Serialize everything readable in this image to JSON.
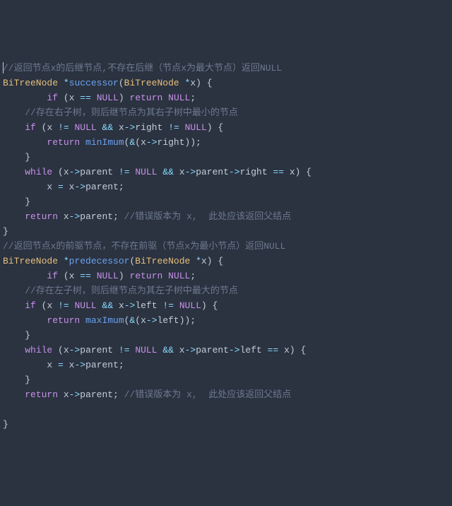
{
  "code": {
    "lines": [
      [
        {
          "cls": "cursor-slot",
          "text": ""
        },
        {
          "cls": "cmt",
          "text": "//返回节点x的后继节点,不存在后继（节点x为最大节点）返回NULL"
        }
      ],
      [
        {
          "cls": "ty",
          "text": "BiTreeNode"
        },
        {
          "cls": "pn",
          "text": " "
        },
        {
          "cls": "op",
          "text": "*"
        },
        {
          "cls": "fn",
          "text": "successor"
        },
        {
          "cls": "pn",
          "text": "("
        },
        {
          "cls": "ty",
          "text": "BiTreeNode"
        },
        {
          "cls": "pn",
          "text": " "
        },
        {
          "cls": "op",
          "text": "*"
        },
        {
          "cls": "id",
          "text": "x"
        },
        {
          "cls": "pn",
          "text": ") {"
        }
      ],
      [
        {
          "cls": "pn",
          "text": "        "
        },
        {
          "cls": "kw",
          "text": "if"
        },
        {
          "cls": "pn",
          "text": " ("
        },
        {
          "cls": "id",
          "text": "x"
        },
        {
          "cls": "pn",
          "text": " "
        },
        {
          "cls": "op",
          "text": "=="
        },
        {
          "cls": "pn",
          "text": " "
        },
        {
          "cls": "kw",
          "text": "NULL"
        },
        {
          "cls": "pn",
          "text": ") "
        },
        {
          "cls": "kw",
          "text": "return"
        },
        {
          "cls": "pn",
          "text": " "
        },
        {
          "cls": "kw",
          "text": "NULL"
        },
        {
          "cls": "pn",
          "text": ";"
        }
      ],
      [
        {
          "cls": "pn",
          "text": "    "
        },
        {
          "cls": "cmt",
          "text": "//存在右子树，则后继节点为其右子树中最小的节点"
        }
      ],
      [
        {
          "cls": "pn",
          "text": "    "
        },
        {
          "cls": "kw",
          "text": "if"
        },
        {
          "cls": "pn",
          "text": " ("
        },
        {
          "cls": "id",
          "text": "x"
        },
        {
          "cls": "pn",
          "text": " "
        },
        {
          "cls": "op",
          "text": "!="
        },
        {
          "cls": "pn",
          "text": " "
        },
        {
          "cls": "kw",
          "text": "NULL"
        },
        {
          "cls": "pn",
          "text": " "
        },
        {
          "cls": "op",
          "text": "&&"
        },
        {
          "cls": "pn",
          "text": " "
        },
        {
          "cls": "id",
          "text": "x"
        },
        {
          "cls": "op",
          "text": "->"
        },
        {
          "cls": "id",
          "text": "right"
        },
        {
          "cls": "pn",
          "text": " "
        },
        {
          "cls": "op",
          "text": "!="
        },
        {
          "cls": "pn",
          "text": " "
        },
        {
          "cls": "kw",
          "text": "NULL"
        },
        {
          "cls": "pn",
          "text": ") {"
        }
      ],
      [
        {
          "cls": "pn",
          "text": "        "
        },
        {
          "cls": "kw",
          "text": "return"
        },
        {
          "cls": "pn",
          "text": " "
        },
        {
          "cls": "fn",
          "text": "minImum"
        },
        {
          "cls": "pn",
          "text": "("
        },
        {
          "cls": "op",
          "text": "&"
        },
        {
          "cls": "pn",
          "text": "("
        },
        {
          "cls": "id",
          "text": "x"
        },
        {
          "cls": "op",
          "text": "->"
        },
        {
          "cls": "id",
          "text": "right"
        },
        {
          "cls": "pn",
          "text": "));"
        }
      ],
      [
        {
          "cls": "pn",
          "text": "    }"
        }
      ],
      [
        {
          "cls": "pn",
          "text": "    "
        },
        {
          "cls": "kw",
          "text": "while"
        },
        {
          "cls": "pn",
          "text": " ("
        },
        {
          "cls": "id",
          "text": "x"
        },
        {
          "cls": "op",
          "text": "->"
        },
        {
          "cls": "id",
          "text": "parent"
        },
        {
          "cls": "pn",
          "text": " "
        },
        {
          "cls": "op",
          "text": "!="
        },
        {
          "cls": "pn",
          "text": " "
        },
        {
          "cls": "kw",
          "text": "NULL"
        },
        {
          "cls": "pn",
          "text": " "
        },
        {
          "cls": "op",
          "text": "&&"
        },
        {
          "cls": "pn",
          "text": " "
        },
        {
          "cls": "id",
          "text": "x"
        },
        {
          "cls": "op",
          "text": "->"
        },
        {
          "cls": "id",
          "text": "parent"
        },
        {
          "cls": "op",
          "text": "->"
        },
        {
          "cls": "id",
          "text": "right"
        },
        {
          "cls": "pn",
          "text": " "
        },
        {
          "cls": "op",
          "text": "=="
        },
        {
          "cls": "pn",
          "text": " "
        },
        {
          "cls": "id",
          "text": "x"
        },
        {
          "cls": "pn",
          "text": ") {"
        }
      ],
      [
        {
          "cls": "pn",
          "text": "        "
        },
        {
          "cls": "id",
          "text": "x"
        },
        {
          "cls": "pn",
          "text": " "
        },
        {
          "cls": "op",
          "text": "="
        },
        {
          "cls": "pn",
          "text": " "
        },
        {
          "cls": "id",
          "text": "x"
        },
        {
          "cls": "op",
          "text": "->"
        },
        {
          "cls": "id",
          "text": "parent"
        },
        {
          "cls": "pn",
          "text": ";"
        }
      ],
      [
        {
          "cls": "pn",
          "text": "    }"
        }
      ],
      [
        {
          "cls": "pn",
          "text": "    "
        },
        {
          "cls": "kw",
          "text": "return"
        },
        {
          "cls": "pn",
          "text": " "
        },
        {
          "cls": "id",
          "text": "x"
        },
        {
          "cls": "op",
          "text": "->"
        },
        {
          "cls": "id",
          "text": "parent"
        },
        {
          "cls": "pn",
          "text": "; "
        },
        {
          "cls": "cmt",
          "text": "//错误版本为 x,  此处应该返回父结点"
        }
      ],
      [
        {
          "cls": "pn",
          "text": "}"
        }
      ],
      [
        {
          "cls": "cmt",
          "text": "//返回节点x的前驱节点，不存在前驱（节点x为最小节点）返回NULL"
        }
      ],
      [
        {
          "cls": "ty",
          "text": "BiTreeNode"
        },
        {
          "cls": "pn",
          "text": " "
        },
        {
          "cls": "op",
          "text": "*"
        },
        {
          "cls": "fn",
          "text": "predecessor"
        },
        {
          "cls": "pn",
          "text": "("
        },
        {
          "cls": "ty",
          "text": "BiTreeNode"
        },
        {
          "cls": "pn",
          "text": " "
        },
        {
          "cls": "op",
          "text": "*"
        },
        {
          "cls": "id",
          "text": "x"
        },
        {
          "cls": "pn",
          "text": ") {"
        }
      ],
      [
        {
          "cls": "pn",
          "text": "        "
        },
        {
          "cls": "kw",
          "text": "if"
        },
        {
          "cls": "pn",
          "text": " ("
        },
        {
          "cls": "id",
          "text": "x"
        },
        {
          "cls": "pn",
          "text": " "
        },
        {
          "cls": "op",
          "text": "=="
        },
        {
          "cls": "pn",
          "text": " "
        },
        {
          "cls": "kw",
          "text": "NULL"
        },
        {
          "cls": "pn",
          "text": ") "
        },
        {
          "cls": "kw",
          "text": "return"
        },
        {
          "cls": "pn",
          "text": " "
        },
        {
          "cls": "kw",
          "text": "NULL"
        },
        {
          "cls": "pn",
          "text": ";"
        }
      ],
      [
        {
          "cls": "pn",
          "text": "    "
        },
        {
          "cls": "cmt",
          "text": "//存在左子树，则后继节点为其左子树中最大的节点"
        }
      ],
      [
        {
          "cls": "pn",
          "text": "    "
        },
        {
          "cls": "kw",
          "text": "if"
        },
        {
          "cls": "pn",
          "text": " ("
        },
        {
          "cls": "id",
          "text": "x"
        },
        {
          "cls": "pn",
          "text": " "
        },
        {
          "cls": "op",
          "text": "!="
        },
        {
          "cls": "pn",
          "text": " "
        },
        {
          "cls": "kw",
          "text": "NULL"
        },
        {
          "cls": "pn",
          "text": " "
        },
        {
          "cls": "op",
          "text": "&&"
        },
        {
          "cls": "pn",
          "text": " "
        },
        {
          "cls": "id",
          "text": "x"
        },
        {
          "cls": "op",
          "text": "->"
        },
        {
          "cls": "id",
          "text": "left"
        },
        {
          "cls": "pn",
          "text": " "
        },
        {
          "cls": "op",
          "text": "!="
        },
        {
          "cls": "pn",
          "text": " "
        },
        {
          "cls": "kw",
          "text": "NULL"
        },
        {
          "cls": "pn",
          "text": ") {"
        }
      ],
      [
        {
          "cls": "pn",
          "text": "        "
        },
        {
          "cls": "kw",
          "text": "return"
        },
        {
          "cls": "pn",
          "text": " "
        },
        {
          "cls": "fn",
          "text": "maxImum"
        },
        {
          "cls": "pn",
          "text": "("
        },
        {
          "cls": "op",
          "text": "&"
        },
        {
          "cls": "pn",
          "text": "("
        },
        {
          "cls": "id",
          "text": "x"
        },
        {
          "cls": "op",
          "text": "->"
        },
        {
          "cls": "id",
          "text": "left"
        },
        {
          "cls": "pn",
          "text": "));"
        }
      ],
      [
        {
          "cls": "pn",
          "text": "    }"
        }
      ],
      [
        {
          "cls": "pn",
          "text": "    "
        },
        {
          "cls": "kw",
          "text": "while"
        },
        {
          "cls": "pn",
          "text": " ("
        },
        {
          "cls": "id",
          "text": "x"
        },
        {
          "cls": "op",
          "text": "->"
        },
        {
          "cls": "id",
          "text": "parent"
        },
        {
          "cls": "pn",
          "text": " "
        },
        {
          "cls": "op",
          "text": "!="
        },
        {
          "cls": "pn",
          "text": " "
        },
        {
          "cls": "kw",
          "text": "NULL"
        },
        {
          "cls": "pn",
          "text": " "
        },
        {
          "cls": "op",
          "text": "&&"
        },
        {
          "cls": "pn",
          "text": " "
        },
        {
          "cls": "id",
          "text": "x"
        },
        {
          "cls": "op",
          "text": "->"
        },
        {
          "cls": "id",
          "text": "parent"
        },
        {
          "cls": "op",
          "text": "->"
        },
        {
          "cls": "id",
          "text": "left"
        },
        {
          "cls": "pn",
          "text": " "
        },
        {
          "cls": "op",
          "text": "=="
        },
        {
          "cls": "pn",
          "text": " "
        },
        {
          "cls": "id",
          "text": "x"
        },
        {
          "cls": "pn",
          "text": ") {"
        }
      ],
      [
        {
          "cls": "pn",
          "text": "        "
        },
        {
          "cls": "id",
          "text": "x"
        },
        {
          "cls": "pn",
          "text": " "
        },
        {
          "cls": "op",
          "text": "="
        },
        {
          "cls": "pn",
          "text": " "
        },
        {
          "cls": "id",
          "text": "x"
        },
        {
          "cls": "op",
          "text": "->"
        },
        {
          "cls": "id",
          "text": "parent"
        },
        {
          "cls": "pn",
          "text": ";"
        }
      ],
      [
        {
          "cls": "pn",
          "text": "    }"
        }
      ],
      [
        {
          "cls": "pn",
          "text": "    "
        },
        {
          "cls": "kw",
          "text": "return"
        },
        {
          "cls": "pn",
          "text": " "
        },
        {
          "cls": "id",
          "text": "x"
        },
        {
          "cls": "op",
          "text": "->"
        },
        {
          "cls": "id",
          "text": "parent"
        },
        {
          "cls": "pn",
          "text": "; "
        },
        {
          "cls": "cmt",
          "text": "//错误版本为 x,  此处应该返回父结点"
        }
      ],
      [],
      [
        {
          "cls": "pn",
          "text": "}"
        }
      ]
    ]
  }
}
